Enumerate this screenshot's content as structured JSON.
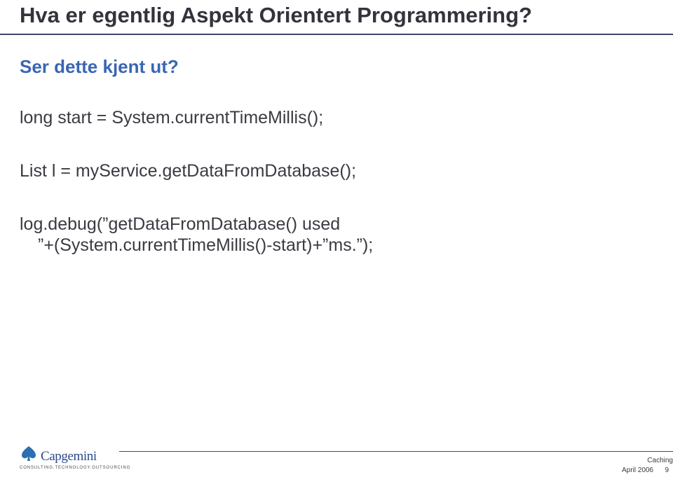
{
  "title": "Hva er egentlig Aspekt Orientert Programmering?",
  "subtitle": "Ser dette kjent ut?",
  "code": {
    "line1": "long start = System.currentTimeMillis();",
    "line2": "List l = myService.getDataFromDatabase();",
    "line3a": "log.debug(”getDataFromDatabase() used",
    "line3b": "”+(System.currentTimeMillis()-start)+”ms.”);"
  },
  "logo": {
    "name": "Capgemini",
    "tagline": "CONSULTING.TECHNOLOGY.OUTSOURCING"
  },
  "footer": {
    "topic": "Caching",
    "date": "April 2006",
    "page": "9"
  }
}
